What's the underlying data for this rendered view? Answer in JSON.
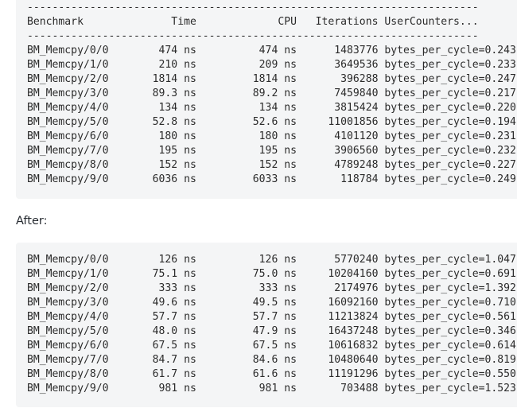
{
  "before_block": {
    "separator": "------------------------------------------------------------------------",
    "header": {
      "benchmark": "Benchmark",
      "time": "Time",
      "cpu": "CPU",
      "iterations": "Iterations",
      "counters": "UserCounters..."
    },
    "rows": [
      {
        "name": "BM_Memcpy/0/0",
        "time": "474",
        "cpu": "474",
        "iterations": "1483776",
        "counter": "bytes_per_cycle=0.243"
      },
      {
        "name": "BM_Memcpy/1/0",
        "time": "210",
        "cpu": "209",
        "iterations": "3649536",
        "counter": "bytes_per_cycle=0.233"
      },
      {
        "name": "BM_Memcpy/2/0",
        "time": "1814",
        "cpu": "1814",
        "iterations": "396288",
        "counter": "bytes_per_cycle=0.247"
      },
      {
        "name": "BM_Memcpy/3/0",
        "time": "89.3",
        "cpu": "89.2",
        "iterations": "7459840",
        "counter": "bytes_per_cycle=0.217"
      },
      {
        "name": "BM_Memcpy/4/0",
        "time": "134",
        "cpu": "134",
        "iterations": "3815424",
        "counter": "bytes_per_cycle=0.220"
      },
      {
        "name": "BM_Memcpy/5/0",
        "time": "52.8",
        "cpu": "52.6",
        "iterations": "11001856",
        "counter": "bytes_per_cycle=0.194"
      },
      {
        "name": "BM_Memcpy/6/0",
        "time": "180",
        "cpu": "180",
        "iterations": "4101120",
        "counter": "bytes_per_cycle=0.231"
      },
      {
        "name": "BM_Memcpy/7/0",
        "time": "195",
        "cpu": "195",
        "iterations": "3906560",
        "counter": "bytes_per_cycle=0.232"
      },
      {
        "name": "BM_Memcpy/8/0",
        "time": "152",
        "cpu": "152",
        "iterations": "4789248",
        "counter": "bytes_per_cycle=0.227"
      },
      {
        "name": "BM_Memcpy/9/0",
        "time": "6036",
        "cpu": "6033",
        "iterations": "118784",
        "counter": "bytes_per_cycle=0.249"
      }
    ]
  },
  "after_label": "After:",
  "after_block": {
    "rows": [
      {
        "name": "BM_Memcpy/0/0",
        "time": "126",
        "cpu": "126",
        "iterations": "5770240",
        "counter": "bytes_per_cycle=1.047"
      },
      {
        "name": "BM_Memcpy/1/0",
        "time": "75.1",
        "cpu": "75.0",
        "iterations": "10204160",
        "counter": "bytes_per_cycle=0.691"
      },
      {
        "name": "BM_Memcpy/2/0",
        "time": "333",
        "cpu": "333",
        "iterations": "2174976",
        "counter": "bytes_per_cycle=1.392"
      },
      {
        "name": "BM_Memcpy/3/0",
        "time": "49.6",
        "cpu": "49.5",
        "iterations": "16092160",
        "counter": "bytes_per_cycle=0.710"
      },
      {
        "name": "BM_Memcpy/4/0",
        "time": "57.7",
        "cpu": "57.7",
        "iterations": "11213824",
        "counter": "bytes_per_cycle=0.561"
      },
      {
        "name": "BM_Memcpy/5/0",
        "time": "48.0",
        "cpu": "47.9",
        "iterations": "16437248",
        "counter": "bytes_per_cycle=0.346"
      },
      {
        "name": "BM_Memcpy/6/0",
        "time": "67.5",
        "cpu": "67.5",
        "iterations": "10616832",
        "counter": "bytes_per_cycle=0.614"
      },
      {
        "name": "BM_Memcpy/7/0",
        "time": "84.7",
        "cpu": "84.6",
        "iterations": "10480640",
        "counter": "bytes_per_cycle=0.819"
      },
      {
        "name": "BM_Memcpy/8/0",
        "time": "61.7",
        "cpu": "61.6",
        "iterations": "11191296",
        "counter": "bytes_per_cycle=0.550"
      },
      {
        "name": "BM_Memcpy/9/0",
        "time": "981",
        "cpu": "981",
        "iterations": "703488",
        "counter": "bytes_per_cycle=1.523"
      }
    ]
  },
  "unit": "ns"
}
